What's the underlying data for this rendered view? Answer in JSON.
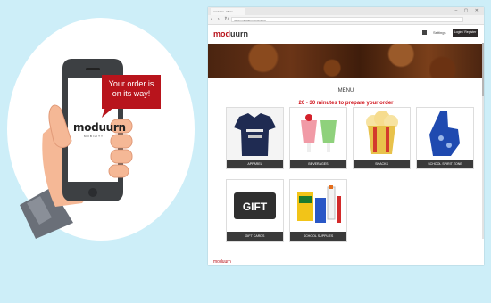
{
  "notification": {
    "message": "Your order is on its way!"
  },
  "phone": {
    "logo": "moduurn",
    "sub": "MOBILITY"
  },
  "browser": {
    "tab_title": "moduurn - Menu",
    "url": "https://moduurn.com/menu"
  },
  "site": {
    "logo_prefix": "mod",
    "logo_suffix": "uurn",
    "settings_label": "Settings",
    "signin_label": "Login / Register",
    "menu_title": "MENU",
    "prep_time": "20 - 30 minutes to prepare your order",
    "categories": [
      {
        "label": "APPAREL",
        "icon": "apparel-shirt-icon"
      },
      {
        "label": "BEVERAGES",
        "icon": "beverages-icon"
      },
      {
        "label": "SNACKS",
        "icon": "popcorn-icon"
      },
      {
        "label": "SCHOOL SPIRIT ZONE",
        "icon": "foam-finger-icon"
      },
      {
        "label": "GIFT CARDS",
        "icon": "gift-card-icon"
      },
      {
        "label": "SCHOOL SUPPLIES",
        "icon": "school-supplies-icon"
      }
    ],
    "gift_text": "GIFT",
    "footer_logo": "moduurn"
  },
  "colors": {
    "accent": "#b8141c",
    "background": "#cdeef8",
    "header_dark": "#2e2a2a"
  }
}
